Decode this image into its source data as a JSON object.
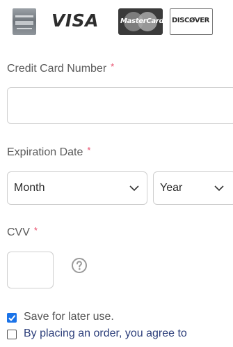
{
  "card_logos": [
    {
      "name": "American Express",
      "icon": "amex-card-icon"
    },
    {
      "name": "Visa",
      "icon": "visa-logo-icon",
      "text": "VISA"
    },
    {
      "name": "MasterCard",
      "icon": "mastercard-logo-icon",
      "text": "MasterCard"
    },
    {
      "name": "Discover",
      "icon": "discover-logo-icon",
      "text": "DISCØVER"
    }
  ],
  "form": {
    "required_mark": "*",
    "credit_card": {
      "label": "Credit Card Number",
      "value": ""
    },
    "expiration": {
      "label": "Expiration Date",
      "month": {
        "selected": "Month"
      },
      "year": {
        "selected": "Year"
      }
    },
    "cvv": {
      "label": "CVV",
      "value": "",
      "help_icon": "question-circle-icon"
    },
    "save_for_later": {
      "label": "Save for later use.",
      "checked": true
    },
    "terms": {
      "label": "By placing an order, you agree to",
      "checked": false
    }
  },
  "colors": {
    "label_text": "#5a5a5a",
    "required": "#e84b6a",
    "checkbox_checked": "#1a73e8",
    "terms_text": "#2c3e7a",
    "input_border": "#cfcfcf"
  }
}
